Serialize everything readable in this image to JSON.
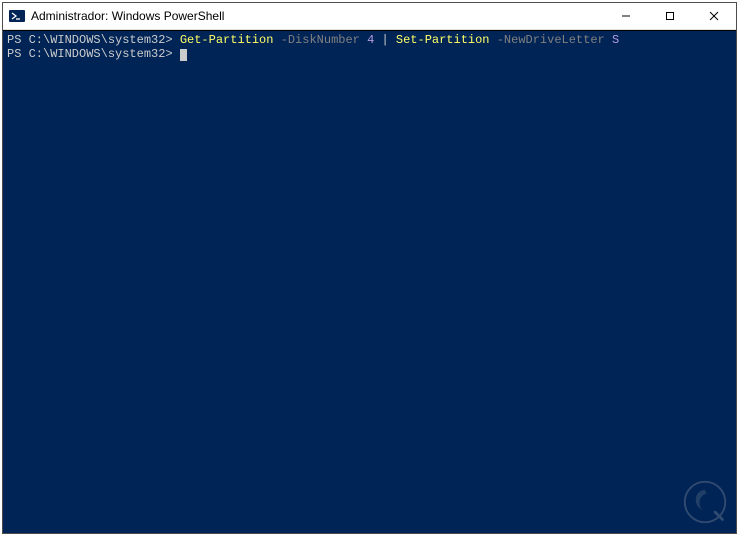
{
  "window": {
    "title": "Administrador: Windows PowerShell"
  },
  "controls": {
    "minimize": "—",
    "maximize": "☐",
    "close": "✕"
  },
  "console": {
    "lines": [
      {
        "prompt": "PS C:\\WINDOWS\\system32> ",
        "tokens": [
          {
            "type": "cmd",
            "text": "Get-Partition"
          },
          {
            "type": "space",
            "text": " "
          },
          {
            "type": "param",
            "text": "-DiskNumber"
          },
          {
            "type": "space",
            "text": " "
          },
          {
            "type": "arg",
            "text": "4"
          },
          {
            "type": "space",
            "text": " "
          },
          {
            "type": "pipe",
            "text": "|"
          },
          {
            "type": "space",
            "text": " "
          },
          {
            "type": "cmd",
            "text": "Set-Partition"
          },
          {
            "type": "space",
            "text": " "
          },
          {
            "type": "param",
            "text": "-NewDriveLetter"
          },
          {
            "type": "space",
            "text": " "
          },
          {
            "type": "arg",
            "text": "S"
          }
        ]
      },
      {
        "prompt": "PS C:\\WINDOWS\\system32> ",
        "cursor": true
      }
    ]
  }
}
